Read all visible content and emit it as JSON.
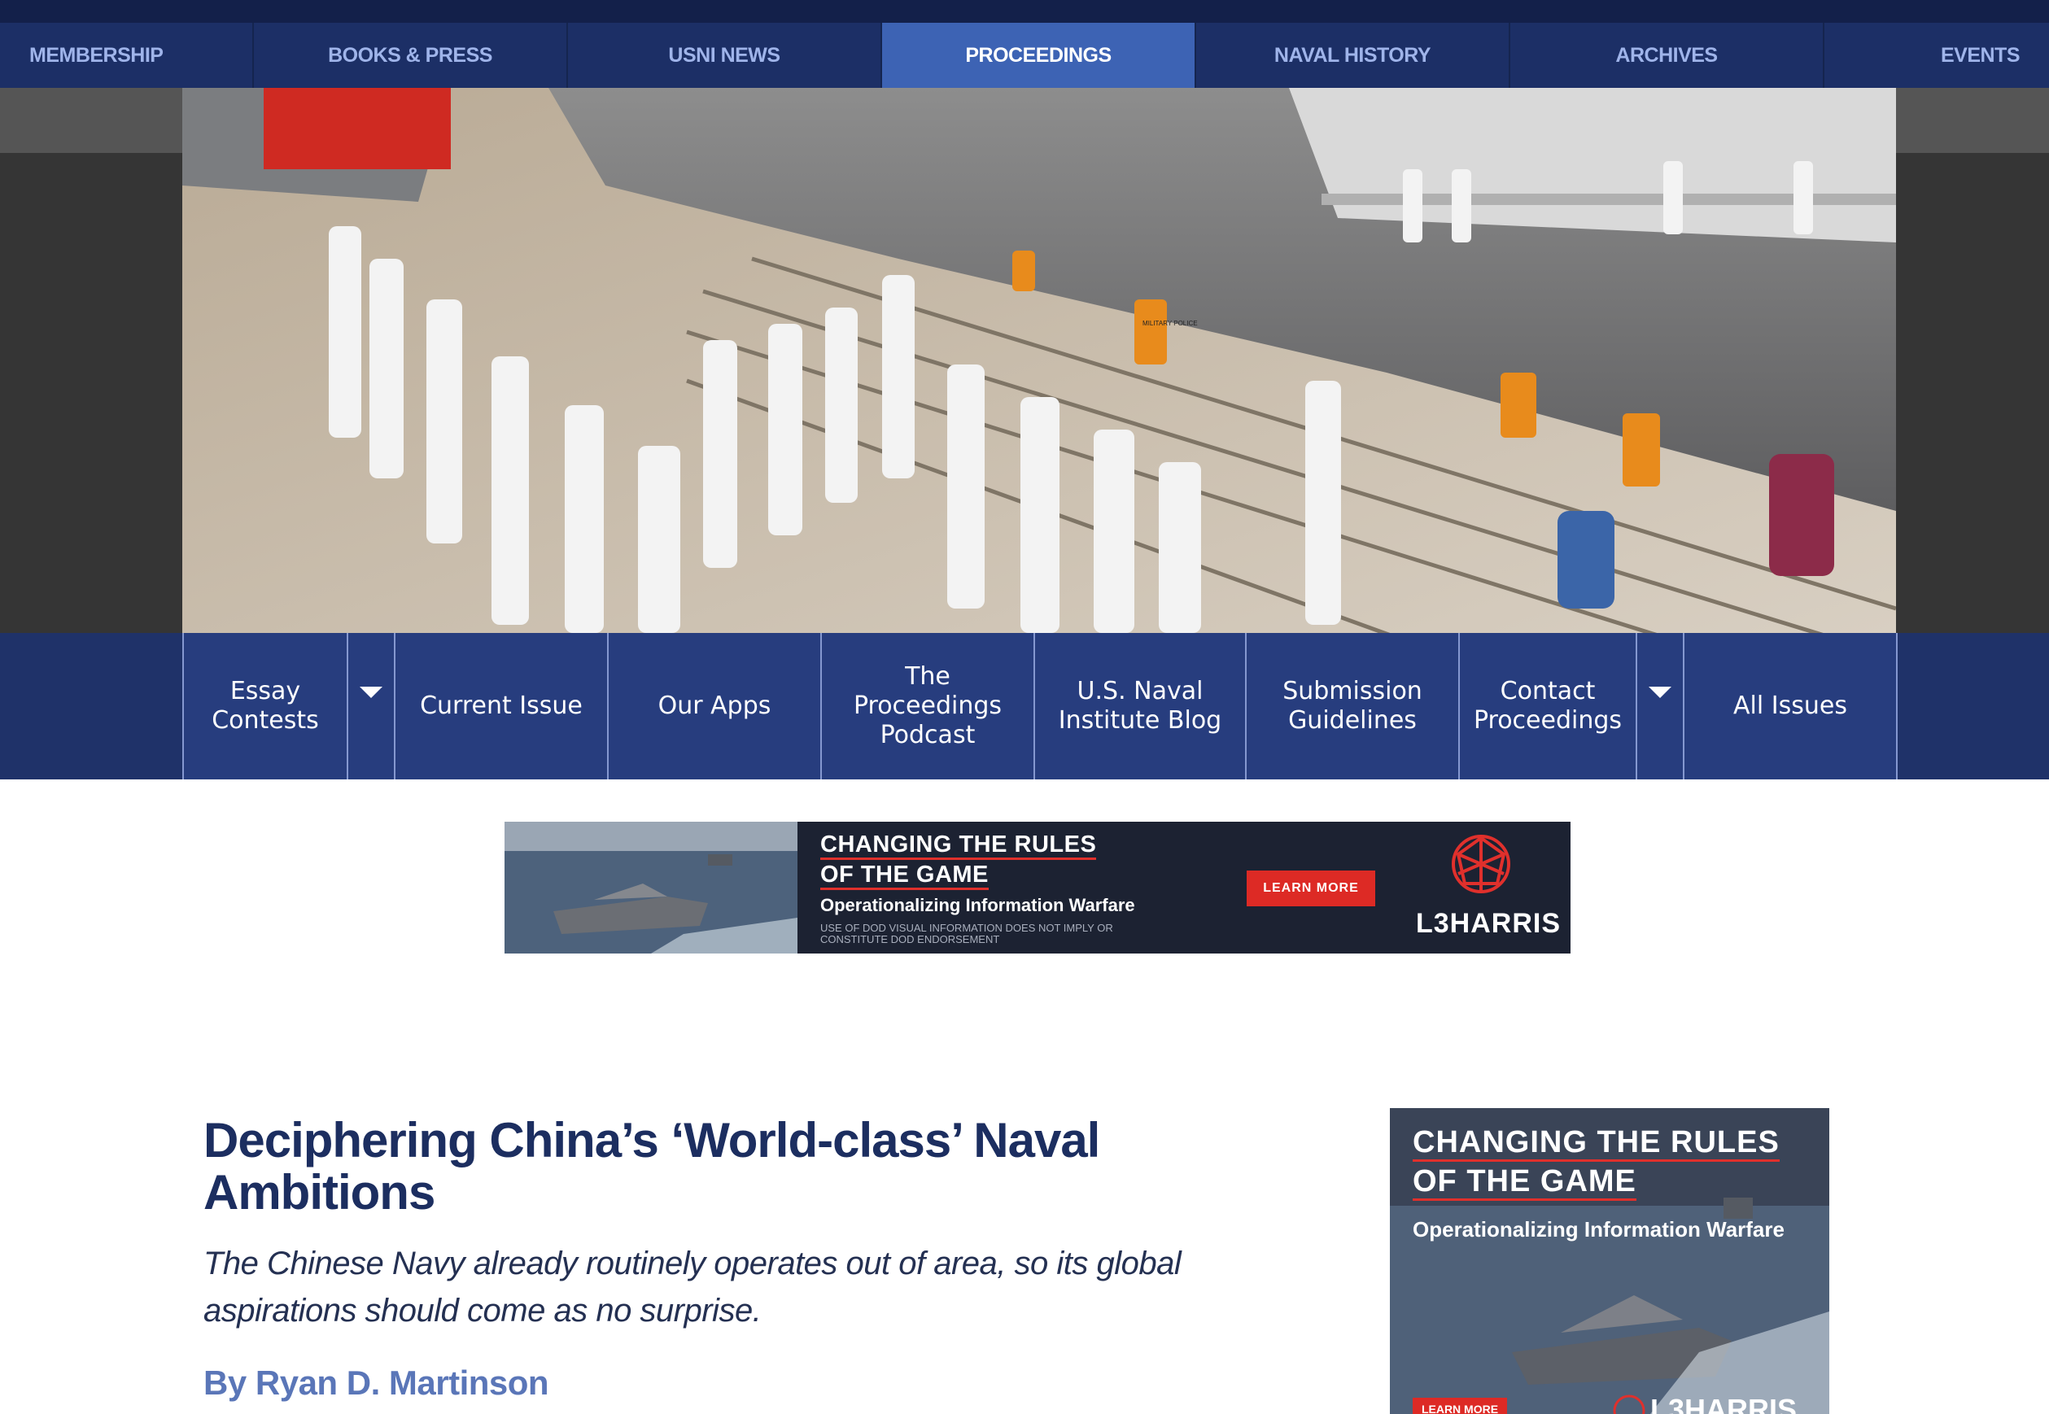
{
  "colors": {
    "navy": "#1c2f66",
    "nav_active": "#3d63b4",
    "nav_text": "#9fb4ea",
    "subnav_item": "#273d7e",
    "title": "#1c2e60",
    "byline": "#5a76b8",
    "ad_red": "#dd2a25"
  },
  "topnav": {
    "items": [
      {
        "label": "MEMBERSHIP"
      },
      {
        "label": "BOOKS & PRESS"
      },
      {
        "label": "USNI NEWS"
      },
      {
        "label": "PROCEEDINGS",
        "active": true
      },
      {
        "label": "NAVAL HISTORY"
      },
      {
        "label": "ARCHIVES"
      },
      {
        "label": "EVENTS"
      }
    ]
  },
  "hero": {
    "image": "naval-ceremony-photo",
    "vest_text": "MILITARY POLICE"
  },
  "subnav": {
    "essay_contests": "Essay Contests",
    "current_issue": "Current Issue",
    "our_apps": "Our Apps",
    "podcast": "The Proceedings Podcast",
    "blog": "U.S. Naval Institute Blog",
    "submission": "Submission Guidelines",
    "contact": "Contact Proceedings",
    "all_issues": "All Issues",
    "caret_icon": "caret-down-icon"
  },
  "banner_ad": {
    "headline_1": "CHANGING THE RULES",
    "headline_2": "OF THE GAME",
    "subhead": "Operationalizing Information Warfare",
    "disclaimer_1": "USE OF DOD VISUAL INFORMATION DOES NOT IMPLY OR",
    "disclaimer_2": "CONSTITUTE DOD ENDORSEMENT",
    "cta": "LEARN MORE",
    "brand": "L3HARRIS"
  },
  "article": {
    "title": "Deciphering China’s ‘World-class’ Naval Ambitions",
    "subtitle": "The Chinese Navy already routinely operates out of area, so its global aspirations should come as no surprise.",
    "byline_prefix": "By",
    "author": "Ryan D. Martinson"
  },
  "side_ad": {
    "headline_1": "CHANGING THE RULES",
    "headline_2": "OF THE GAME",
    "subhead": "Operationalizing Information Warfare",
    "cta": "LEARN MORE",
    "brand": "L3HARRIS"
  }
}
